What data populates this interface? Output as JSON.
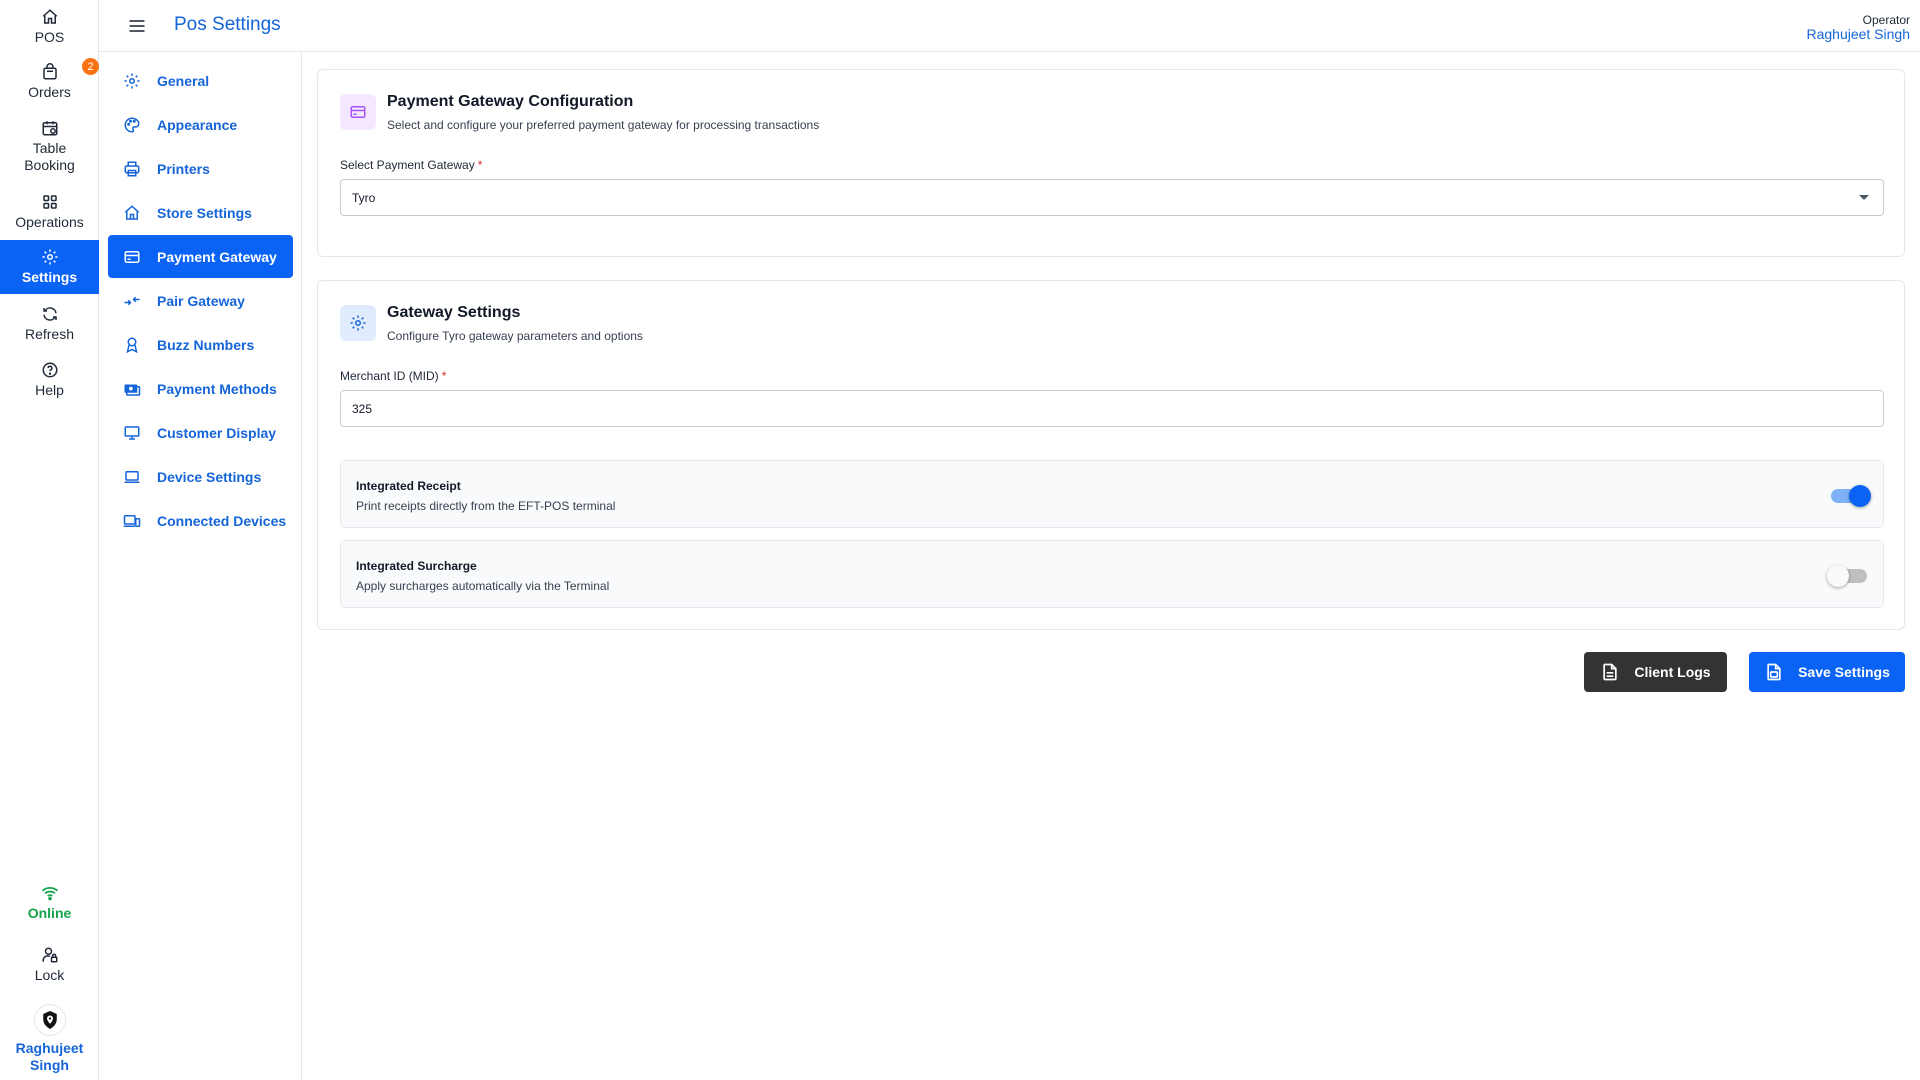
{
  "rail": {
    "items": [
      {
        "label": "POS",
        "icon": "home-icon"
      },
      {
        "label": "Orders",
        "icon": "bag-icon",
        "badge": "2"
      },
      {
        "label": "Table Booking",
        "icon": "calendar-icon"
      },
      {
        "label": "Operations",
        "icon": "grid-icon"
      },
      {
        "label": "Settings",
        "icon": "gear-icon",
        "active": true
      },
      {
        "label": "Refresh",
        "icon": "refresh-icon"
      },
      {
        "label": "Help",
        "icon": "help-icon"
      }
    ],
    "status": {
      "label": "Online",
      "icon": "wifi-icon",
      "color": "#16a34a"
    },
    "lock": {
      "label": "Lock",
      "icon": "user-lock-icon"
    },
    "user": {
      "label": "Raghujeet Singh",
      "icon": "avatar"
    }
  },
  "header": {
    "title": "Pos Settings",
    "operator_role": "Operator",
    "operator_name": "Raghujeet Singh"
  },
  "settings_nav": {
    "items": [
      {
        "label": "General",
        "icon": "gear-icon"
      },
      {
        "label": "Appearance",
        "icon": "palette-icon"
      },
      {
        "label": "Printers",
        "icon": "printer-icon"
      },
      {
        "label": "Store Settings",
        "icon": "store-icon"
      },
      {
        "label": "Payment Gateway",
        "icon": "card-icon",
        "active": true
      },
      {
        "label": "Pair Gateway",
        "icon": "pair-arrows-icon"
      },
      {
        "label": "Buzz Numbers",
        "icon": "badge-icon"
      },
      {
        "label": "Payment Methods",
        "icon": "cash-icon"
      },
      {
        "label": "Customer Display",
        "icon": "monitor-icon"
      },
      {
        "label": "Device Settings",
        "icon": "laptop-icon"
      },
      {
        "label": "Connected Devices",
        "icon": "devices-icon"
      }
    ]
  },
  "gateway_config": {
    "title": "Payment Gateway Configuration",
    "subtitle": "Select and configure your preferred payment gateway for processing transactions",
    "select_label": "Select Payment Gateway",
    "required_mark": "*",
    "selected_value": "Tyro"
  },
  "gateway_settings": {
    "title": "Gateway Settings",
    "subtitle": "Configure Tyro gateway parameters and options",
    "mid_label": "Merchant ID (MID)",
    "required_mark": "*",
    "mid_value": "325",
    "toggles": [
      {
        "title": "Integrated Receipt",
        "description": "Print receipts directly from the EFT-POS terminal",
        "enabled": true
      },
      {
        "title": "Integrated Surcharge",
        "description": "Apply surcharges automatically via the Terminal",
        "enabled": false
      }
    ]
  },
  "actions": {
    "client_logs": "Client Logs",
    "save_settings": "Save Settings"
  },
  "colors": {
    "primary": "#0b63f6",
    "link": "#1565d8",
    "online": "#16a34a",
    "badge": "#f97316",
    "dark_button": "#333333"
  }
}
